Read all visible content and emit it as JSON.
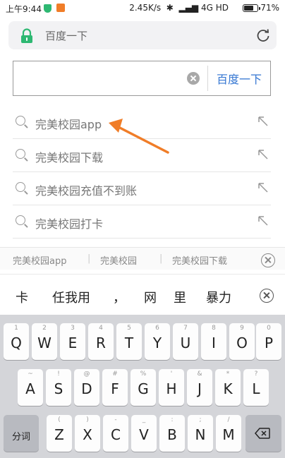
{
  "status_bar": {
    "time": "上午9:44",
    "network_speed": "2.45K/s",
    "network_type": "4G HD",
    "battery_percent": "71%",
    "battery_level": 0.71
  },
  "url_bar": {
    "url_text": "百度一下"
  },
  "search": {
    "value": "",
    "button_label": "百度一下"
  },
  "suggestions": [
    {
      "text": "完美校园app"
    },
    {
      "text": "完美校园下载"
    },
    {
      "text": "完美校园充值不到账"
    },
    {
      "text": "完美校园打卡"
    }
  ],
  "history": {
    "items": [
      "完美校园app",
      "完美校园",
      "完美校园下载"
    ]
  },
  "ime_candidates": [
    "卡",
    "任我用",
    "，",
    "网",
    "里",
    "暴力"
  ],
  "keyboard": {
    "row1": [
      {
        "sub": "1",
        "key": "Q"
      },
      {
        "sub": "2",
        "key": "W"
      },
      {
        "sub": "3",
        "key": "E"
      },
      {
        "sub": "4",
        "key": "R"
      },
      {
        "sub": "5",
        "key": "T"
      },
      {
        "sub": "6",
        "key": "Y"
      },
      {
        "sub": "7",
        "key": "U"
      },
      {
        "sub": "8",
        "key": "I"
      },
      {
        "sub": "9",
        "key": "O"
      },
      {
        "sub": "0",
        "key": "P"
      }
    ],
    "row2": [
      {
        "sub": "~",
        "key": "A"
      },
      {
        "sub": "!",
        "key": "S"
      },
      {
        "sub": "@",
        "key": "D"
      },
      {
        "sub": "#",
        "key": "F"
      },
      {
        "sub": "%",
        "key": "G"
      },
      {
        "sub": "'",
        "key": "H"
      },
      {
        "sub": "&",
        "key": "J"
      },
      {
        "sub": "*",
        "key": "K"
      },
      {
        "sub": "?",
        "key": "L"
      }
    ],
    "row3": [
      {
        "sub": "(",
        "key": "Z"
      },
      {
        "sub": ")",
        "key": "X"
      },
      {
        "sub": "-",
        "key": "C"
      },
      {
        "sub": "_",
        "key": "V"
      },
      {
        "sub": ":",
        "key": "B"
      },
      {
        "sub": ";",
        "key": "N"
      },
      {
        "sub": "/",
        "key": "M"
      }
    ],
    "segment_label": "分词"
  },
  "colors": {
    "accent_blue": "#3476d2",
    "annotation_orange": "#f07d28",
    "shield_green": "#2eb872"
  }
}
